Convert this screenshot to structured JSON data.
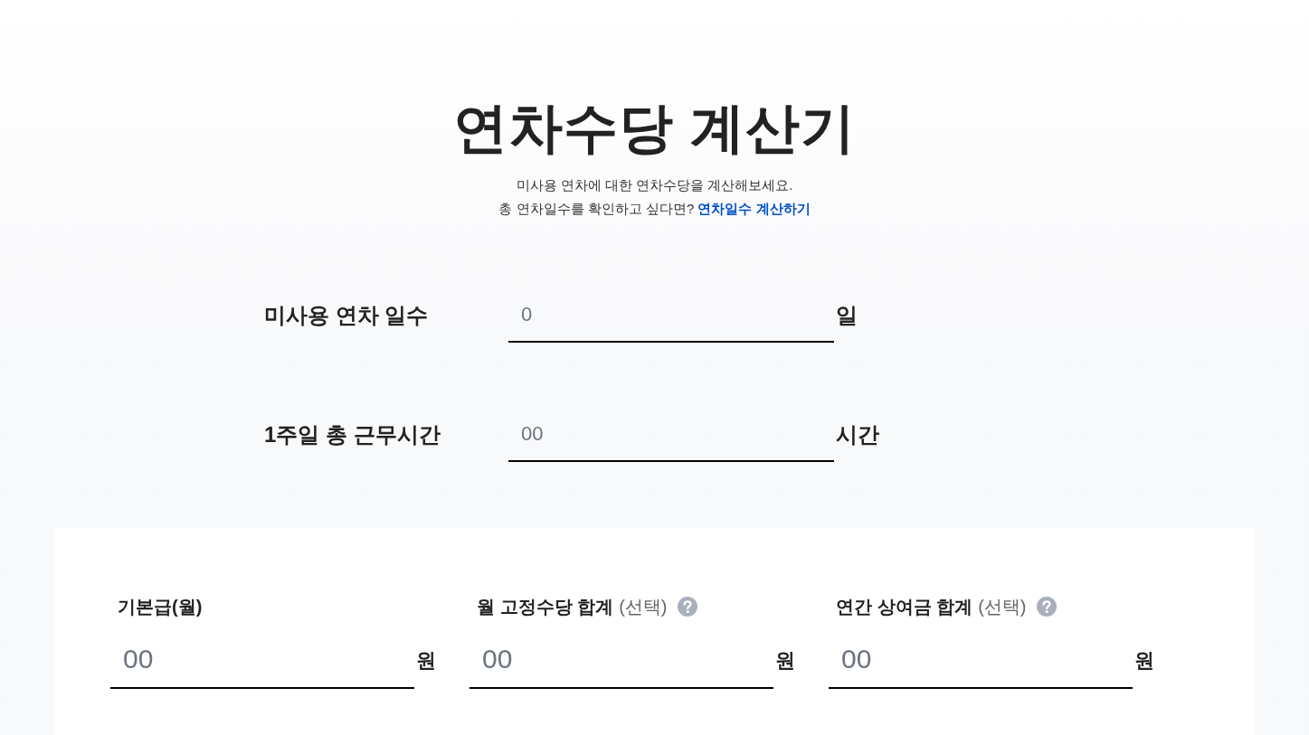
{
  "header": {
    "title": "연차수당 계산기",
    "description": "미사용 연차에 대한 연차수당을 계산해보세요.",
    "prompt": "총 연차일수를 확인하고 싶다면?",
    "link": "연차일수 계산하기"
  },
  "fields": [
    {
      "label": "미사용 연차 일수",
      "placeholder": "0",
      "unit": "일"
    },
    {
      "label": "1주일 총 근무시간",
      "placeholder": "00",
      "unit": "시간"
    }
  ],
  "pay_fields": [
    {
      "label": "기본급(월)",
      "placeholder": "00",
      "unit": "원",
      "help": false
    },
    {
      "label": "월 고정수당 합계",
      "note": "(선택)",
      "placeholder": "00",
      "unit": "원",
      "help": true
    },
    {
      "label": "연간 상여금 합계",
      "note": "(선택)",
      "placeholder": "00",
      "unit": "원",
      "help": true
    }
  ]
}
